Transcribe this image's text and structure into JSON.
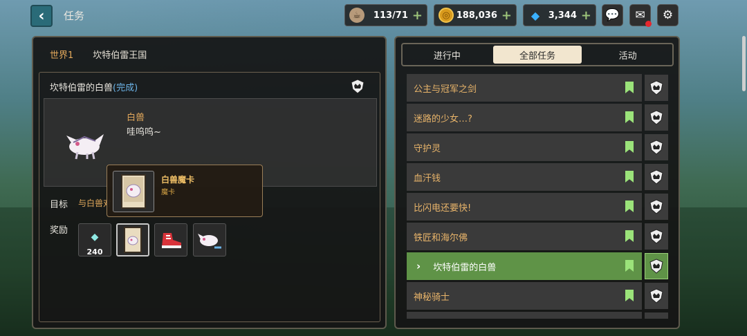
{
  "header": {
    "title": "任务"
  },
  "resources": [
    {
      "name": "stamina",
      "icon": "coffee-cup-icon",
      "value": "113/71"
    },
    {
      "name": "meso",
      "icon": "gold-coin-icon",
      "value": "188,036"
    },
    {
      "name": "crystal",
      "icon": "blue-diamond-icon",
      "value": "3,344"
    }
  ],
  "left": {
    "world": "世界1",
    "region": "坎特伯雷王国",
    "quest_title": "坎特伯雷的白兽",
    "quest_status": "(完成)",
    "npc_name": "白兽",
    "npc_line": "哇呜呜~",
    "goal_label": "目标",
    "goal_value": "与白兽对",
    "reward_label": "奖励",
    "rewards": [
      {
        "icon": "crystal-shard-icon",
        "count": "240"
      },
      {
        "icon": "monster-card-icon",
        "count": ""
      },
      {
        "icon": "red-sneaker-icon",
        "count": ""
      },
      {
        "icon": "white-beast-icon",
        "count": ""
      }
    ],
    "tooltip": {
      "name": "白兽魔卡",
      "type": "魔卡"
    }
  },
  "right": {
    "tabs": [
      "进行中",
      "全部任务",
      "活动"
    ],
    "active_tab": 1,
    "quests": [
      {
        "name": "公主与冠军之剑",
        "active": false
      },
      {
        "name": "迷路的少女…?",
        "active": false
      },
      {
        "name": "守护灵",
        "active": false
      },
      {
        "name": "血汗钱",
        "active": false
      },
      {
        "name": "比闪电还要快!",
        "active": false
      },
      {
        "name": "铁匠和海尔佛",
        "active": false
      },
      {
        "name": "坎特伯雷的白兽",
        "active": true
      },
      {
        "name": "神秘骑士",
        "active": false
      }
    ]
  },
  "colors": {
    "accent_green": "#5f9347",
    "flag_green": "#9be37a",
    "quest_orange": "#e8b46a",
    "done_blue": "#6cb4e8"
  }
}
